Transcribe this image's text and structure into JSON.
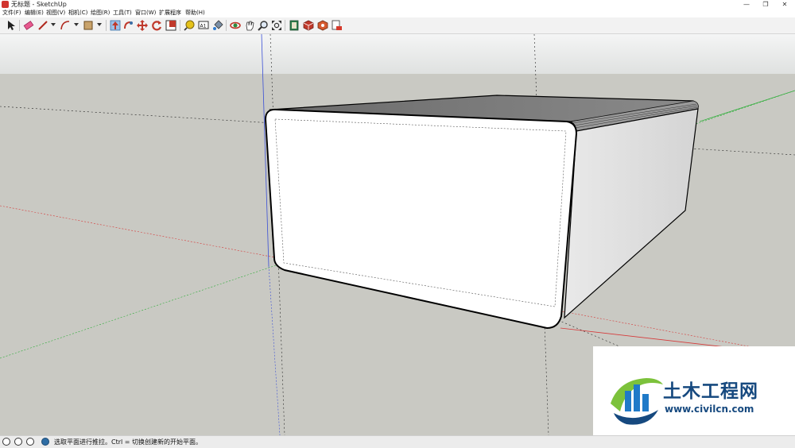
{
  "window": {
    "title": "无标题 - SketchUp",
    "controls": [
      "—",
      "❐",
      "✕"
    ]
  },
  "menu": [
    "文件(F)",
    "编辑(E)",
    "视图(V)",
    "相机(C)",
    "绘图(R)",
    "工具(T)",
    "窗口(W)",
    "扩展程序",
    "帮助(H)"
  ],
  "toolbar": {
    "tools": [
      "select-icon",
      "eraser-icon",
      "line-icon",
      "arc-icon",
      "rectangle-icon",
      "push-pull-icon",
      "follow-me-icon",
      "move-icon",
      "rotate-icon",
      "scale-icon",
      "tape-measure-icon",
      "text-icon",
      "paint-bucket-icon",
      "orbit-icon",
      "pan-icon",
      "zoom-icon",
      "zoom-extents-icon",
      "warehouse-icon",
      "extension-warehouse-icon",
      "layout-icon",
      "send-to-layout-icon"
    ]
  },
  "status": {
    "text": "选取平面进行推拉。Ctrl = 切换创建新的开始平面。",
    "icons": [
      "geo-location-icon",
      "credits-icon",
      "user-icon",
      "instructor-icon"
    ]
  },
  "watermark": {
    "name": "土木工程网",
    "url": "www.civilcn.com"
  },
  "colors": {
    "sky": "#e3e5e4",
    "ground": "#c9c9c3",
    "accent": "#16497f",
    "logo_green": "#7cc23b"
  }
}
